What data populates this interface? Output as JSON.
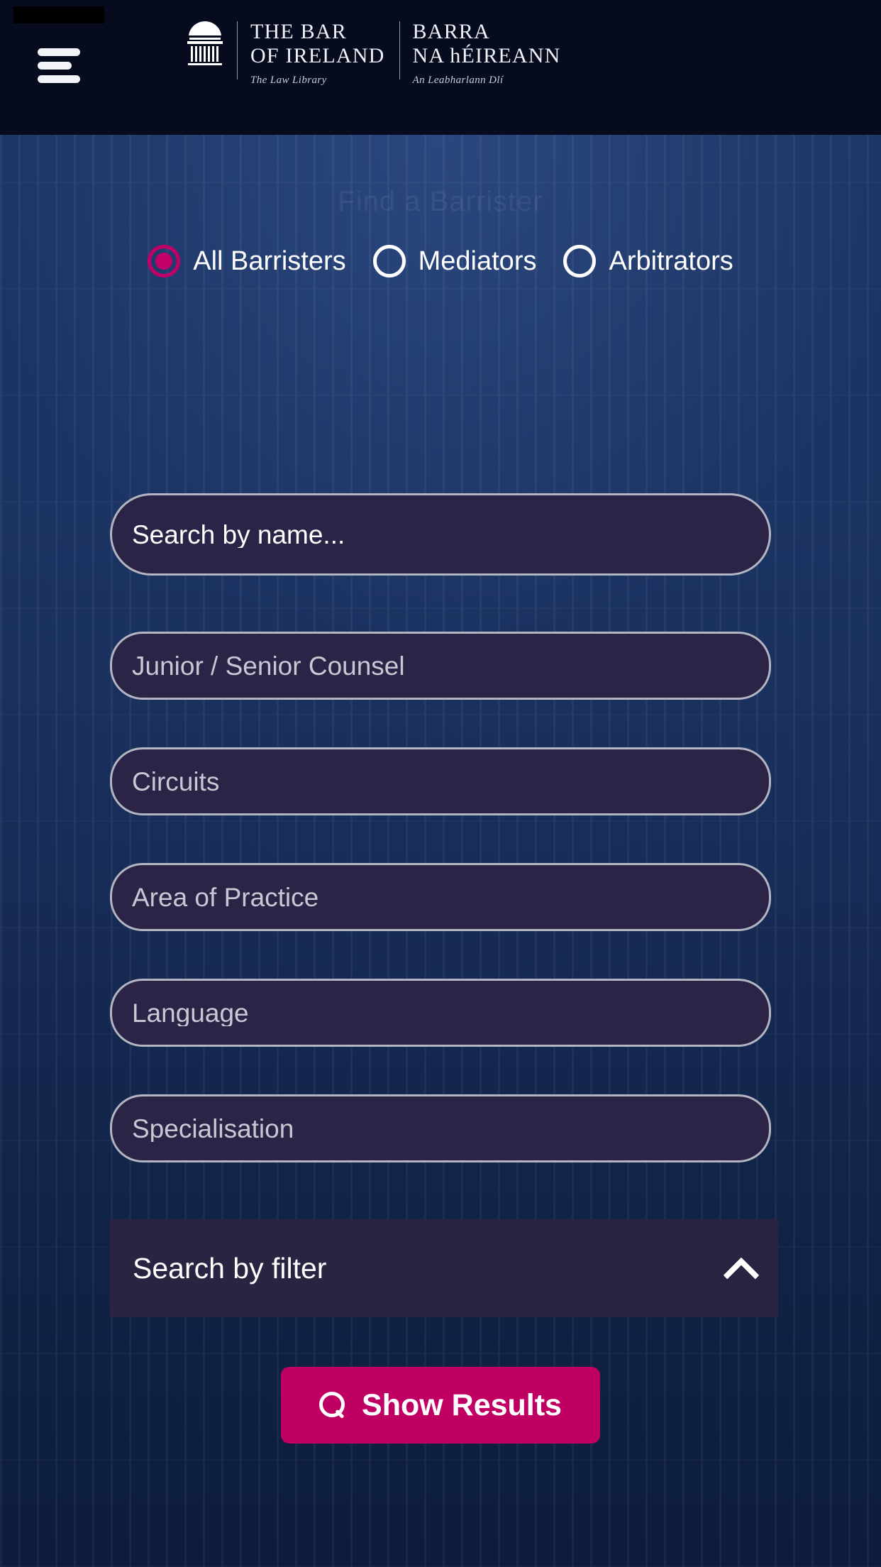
{
  "header": {
    "menu_icon": "hamburger-icon",
    "logo": {
      "mark": "classical-building-icon",
      "english": {
        "line1": "THE BAR",
        "line2": "OF IRELAND",
        "sub": "The Law Library"
      },
      "irish": {
        "line1": "BARRA",
        "line2": "NA hÉIREANN",
        "sub": "An Leabharlann Dlí"
      }
    },
    "background_color": "#060b1d"
  },
  "hero": {
    "faint_heading": "Find a Barrister",
    "background_gradient_top": "#1d3562",
    "background_gradient_bottom": "#0d1c3c"
  },
  "search_type": {
    "options": [
      {
        "label": "All Barristers",
        "selected": true
      },
      {
        "label": "Mediators",
        "selected": false
      },
      {
        "label": "Arbitrators",
        "selected": false
      }
    ],
    "selected_color": "#c30068",
    "unselected_color": "#ffffff"
  },
  "form": {
    "name_search": {
      "placeholder": "Search by name...",
      "value": ""
    },
    "dropdowns": [
      {
        "label": "Junior / Senior Counsel",
        "value": ""
      },
      {
        "label": "Circuits",
        "value": ""
      },
      {
        "label": "Area of Practice",
        "value": ""
      },
      {
        "label": "Language",
        "value": ""
      },
      {
        "label": "Specialisation",
        "value": ""
      }
    ],
    "field_fill": "#2b2447",
    "field_border": "#b3b6c2"
  },
  "filter_panel": {
    "title": "Search by filter",
    "expanded": true,
    "chevron": "chevron-up-icon",
    "background": "#2a2442"
  },
  "submit": {
    "label": "Show Results",
    "icon": "search-icon",
    "color": "#bf0062"
  }
}
